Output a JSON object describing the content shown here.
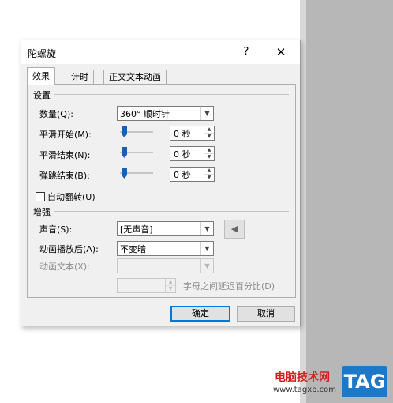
{
  "dialog": {
    "title": "陀螺旋",
    "help_label": "?",
    "close_label": "✕"
  },
  "tabs": [
    {
      "label": "效果",
      "active": true
    },
    {
      "label": "计时",
      "active": false
    },
    {
      "label": "正文文本动画",
      "active": false
    }
  ],
  "settings": {
    "section_title": "设置",
    "amount_label": "数量(Q):",
    "amount_value": "360° 顺时针",
    "smooth_start_label": "平滑开始(M):",
    "smooth_start_value": "0 秒",
    "smooth_end_label": "平滑结束(N):",
    "smooth_end_value": "0 秒",
    "bounce_end_label": "弹跳结束(B):",
    "bounce_end_value": "0 秒",
    "auto_reverse_label": "自动翻转(U)",
    "auto_reverse_checked": false
  },
  "enhance": {
    "section_title": "增强",
    "sound_label": "声音(S):",
    "sound_value": "[无声音]",
    "after_anim_label": "动画播放后(A):",
    "after_anim_value": "不变暗",
    "anim_text_label": "动画文本(X):",
    "anim_text_value": "",
    "letter_delay_value": "",
    "letter_delay_label": "字母之间延迟百分比(D)"
  },
  "buttons": {
    "ok": "确定",
    "cancel": "取消"
  },
  "watermark": {
    "site_name": "电脑技术网",
    "url": "www.tagxp.com",
    "tag": "TAG"
  },
  "colors": {
    "accent": "#0078d7",
    "slider_thumb": "#1a5fb4",
    "dialog_bg": "#f0f0f0"
  }
}
